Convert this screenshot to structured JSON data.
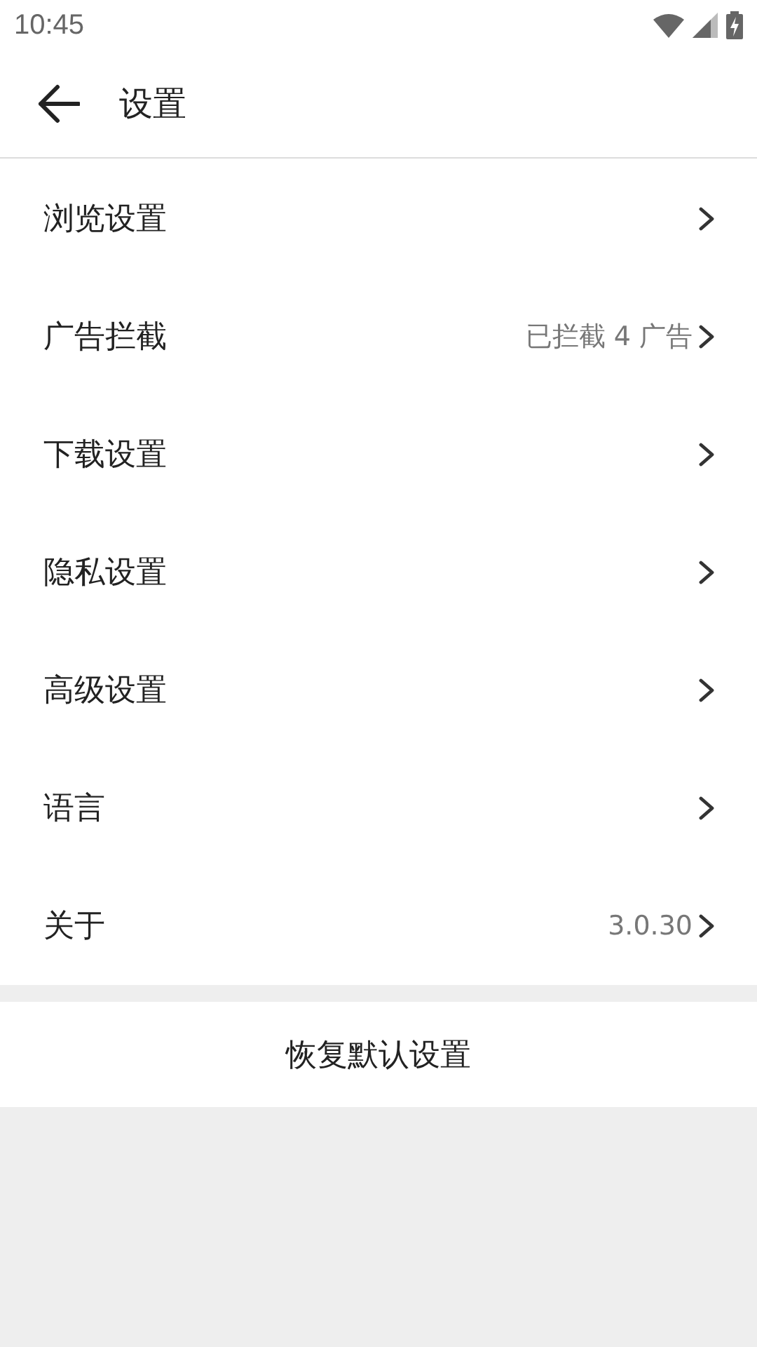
{
  "status_bar": {
    "time": "10:45"
  },
  "header": {
    "title": "设置"
  },
  "settings": [
    {
      "label": "浏览设置"
    },
    {
      "label": "广告拦截",
      "value": "已拦截 4 广告"
    },
    {
      "label": "下载设置"
    },
    {
      "label": "隐私设置"
    },
    {
      "label": "高级设置"
    },
    {
      "label": "语言"
    },
    {
      "label": "关于",
      "value": "3.0.30"
    }
  ],
  "reset_button": {
    "label": "恢复默认设置"
  }
}
